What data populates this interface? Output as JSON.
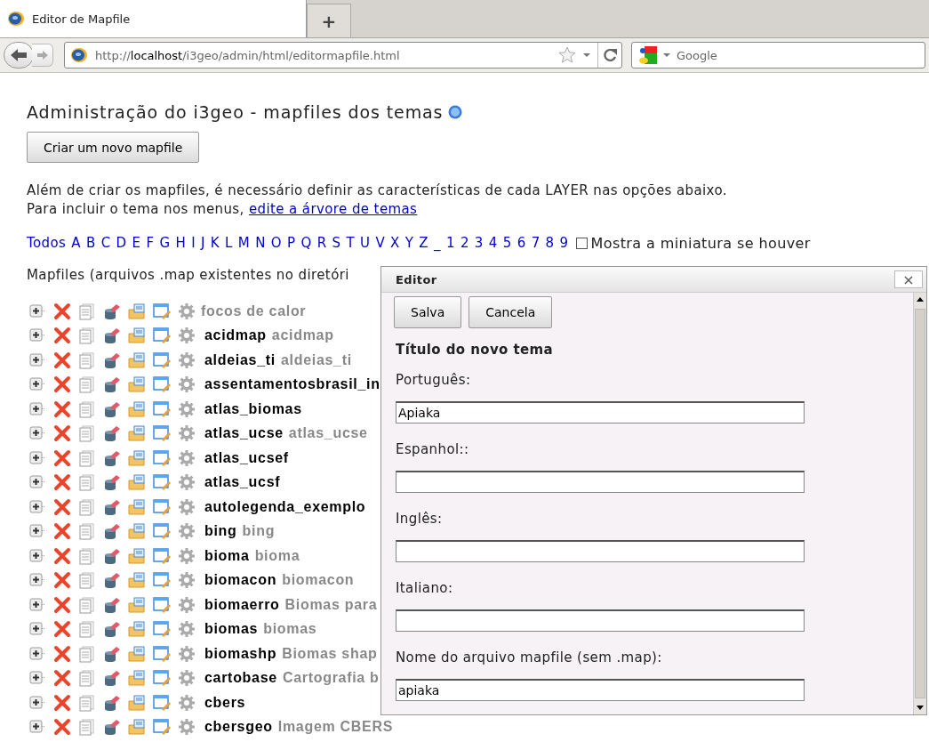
{
  "browser": {
    "tab_title": "Editor de Mapfile",
    "new_tab": "+",
    "url_prefix": "http://",
    "url_host": "localhost",
    "url_path": "/i3geo/admin/html/editormapfile.html",
    "search_placeholder": "Google"
  },
  "page": {
    "title": "Administração do i3geo - mapfiles dos temas",
    "create_button": "Criar um novo mapfile",
    "intro": "Além de criar os mapfiles, é necessário definir as características de cada LAYER nas opções abaixo.",
    "menu_prefix": "Para incluir o tema nos menus, ",
    "menu_link": "edite a árvore de temas",
    "letters": [
      "Todos",
      "A",
      "B",
      "C",
      "D",
      "E",
      "F",
      "G",
      "H",
      "I",
      "J",
      "K",
      "L",
      "M",
      "N",
      "O",
      "P",
      "Q",
      "R",
      "S",
      "T",
      "U",
      "V",
      "X",
      "Y",
      "Z",
      "_",
      "1",
      "2",
      "3",
      "4",
      "5",
      "6",
      "7",
      "8",
      "9"
    ],
    "thumbnail_option": {
      "label": "Mostra a miniatura se houver",
      "checked": false
    },
    "list_heading": "Mapfiles (arquivos .map existentes no diretóri",
    "mapfiles": [
      {
        "title": "focos de calor"
      },
      {
        "name": "acidmap",
        "title": "acidmap"
      },
      {
        "name": "aldeias_ti",
        "title": "aldeias_ti"
      },
      {
        "name": "assentamentosbrasil_in"
      },
      {
        "name": "atlas_biomas"
      },
      {
        "name": "atlas_ucse",
        "title": "atlas_ucse"
      },
      {
        "name": "atlas_ucsef"
      },
      {
        "name": "atlas_ucsf"
      },
      {
        "name": "autolegenda_exemplo"
      },
      {
        "name": "bing",
        "title": "bing"
      },
      {
        "name": "bioma",
        "title": "bioma"
      },
      {
        "name": "biomacon",
        "title": "biomacon"
      },
      {
        "name": "biomaerro",
        "title": "Biomas para"
      },
      {
        "name": "biomas",
        "title": "biomas"
      },
      {
        "name": "biomashp",
        "title": "Biomas shap"
      },
      {
        "name": "cartobase",
        "title": "Cartografia b"
      },
      {
        "name": "cbers"
      },
      {
        "name": "cbersgeo",
        "title": "Imagem CBERS"
      }
    ]
  },
  "editor": {
    "title": "Editor",
    "close": "×",
    "buttons": [
      "Salva",
      "Cancela"
    ],
    "heading": "Título do novo tema",
    "fields": [
      {
        "label": "Português:",
        "value": "Apiaka"
      },
      {
        "label": "Espanhol::"
      },
      {
        "label": "Inglês:"
      },
      {
        "label": "Italiano:"
      },
      {
        "label": "Nome do arquivo mapfile (sem .map):",
        "value": "apiaka"
      }
    ]
  }
}
